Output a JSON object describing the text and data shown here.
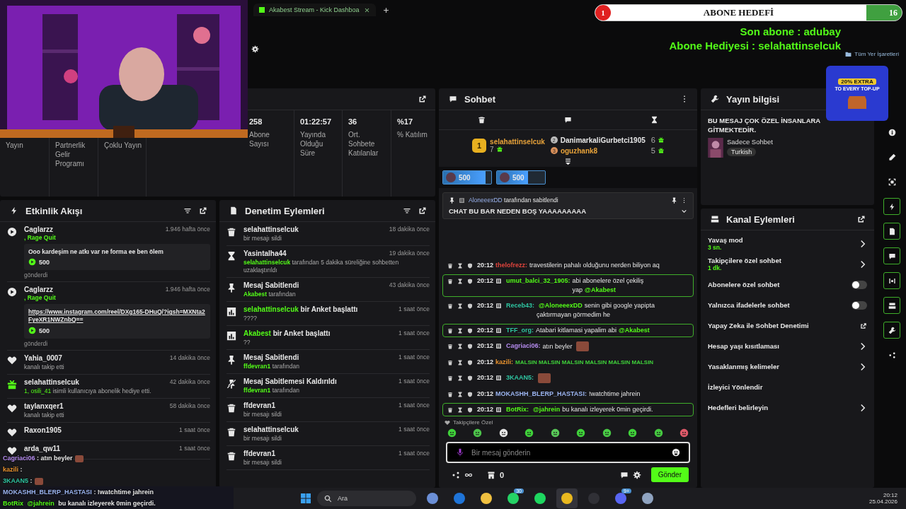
{
  "browser": {
    "tab_title": "Akabest Stream - Kick Dashboa",
    "bookmarks": "Tüm Yer İşaretleri"
  },
  "webcam": {
    "kind": "picture"
  },
  "sub_goal": {
    "title": "ABONE HEDEFİ",
    "current": "1",
    "target": "16"
  },
  "overlay_notices": [
    "Son abone : adubay",
    "Abone Hediyesi : selahattinselcuk"
  ],
  "ad": {
    "headline": "20% EXTRA",
    "subline": "TO EVERY TOP-UP"
  },
  "stats": [
    {
      "label": "Yayın"
    },
    {
      "label": "Partnerlik Gelir Programı"
    },
    {
      "label": "Çoklu Yayın"
    },
    {
      "value": "258",
      "label": "Abone Sayısı"
    },
    {
      "value": "01:22:57",
      "label": "Yayında Olduğu Süre"
    },
    {
      "value": "36",
      "label": "Ort. Sohbete Katılanlar"
    },
    {
      "value": "%17",
      "label": "% Katılım"
    }
  ],
  "events": {
    "title": "Etkinlik Akışı",
    "items": [
      {
        "kind": "kicks",
        "user": "Caglarzz",
        "sub": ", Rage Quit",
        "time": "1.946 hafta önce",
        "message": "Ooo kardeşim ne atkı var ne forma ee ben ölem",
        "link": false,
        "amount": "500",
        "footer": "gönderdi"
      },
      {
        "kind": "kicks",
        "user": "Caglarzz",
        "sub": ", Rage Quit",
        "time": "1.946 hafta önce",
        "message": "https://www.instagram.com/reel/DXg165-DHuQ/?igsh=MXNta2FyeXR1NWZnbQ==",
        "link": true,
        "amount": "500",
        "footer": "gönderdi"
      },
      {
        "kind": "follow",
        "user": "Yahia_0007",
        "time": "14 dakika önce",
        "text": "kanalı takip etti"
      },
      {
        "kind": "gift",
        "user": "selahattinselcuk",
        "time": "42 dakika önce",
        "highlight": "1, osili_41",
        "text": "isimli kullanıcıya abonelik hediye etti."
      },
      {
        "kind": "follow",
        "user": "taylanxqer1",
        "time": "58 dakika önce",
        "text": "kanalı takip etti"
      },
      {
        "kind": "follow",
        "user": "Raxon1905",
        "time": "1 saat önce"
      },
      {
        "kind": "follow",
        "user": "arda_qw11",
        "time": "1 saat önce"
      }
    ]
  },
  "moderation": {
    "title": "Denetim Eylemleri",
    "items": [
      {
        "kind": "delete",
        "title": "selahattinselcuk",
        "sub": "bir mesajı sildi",
        "time": "18 dakika önce"
      },
      {
        "kind": "timeout",
        "title": "Yasintalha44",
        "actor": "selahattinselcuk",
        "sub": "tarafından 5 dakika süreliğine sohbetten uzaklaştırıldı",
        "time": "19 dakika önce"
      },
      {
        "kind": "pin",
        "title": "Mesaj Sabitlendi",
        "actor": "Akabest",
        "sub": "tarafından",
        "time": "43 dakika önce"
      },
      {
        "kind": "poll",
        "title_actor": "selahattinselcuk",
        "title": "bir Anket başlattı",
        "sub": "????",
        "time": "1 saat önce"
      },
      {
        "kind": "poll",
        "title_actor": "Akabest",
        "title": "bir Anket başlattı",
        "sub": "??",
        "time": "1 saat önce"
      },
      {
        "kind": "pin",
        "title": "Mesaj Sabitlendi",
        "actor": "ffdevran1",
        "sub": "tarafından",
        "time": "1 saat önce"
      },
      {
        "kind": "unpin",
        "title": "Mesaj Sabitlemesi Kaldırıldı",
        "actor": "ffdevran1",
        "sub": "tarafından",
        "time": "1 saat önce"
      },
      {
        "kind": "delete",
        "title": "ffdevran1",
        "sub": "bir mesajı sildi",
        "time": "1 saat önce"
      },
      {
        "kind": "delete",
        "title": "selahattinselcuk",
        "sub": "bir mesajı sildi",
        "time": "1 saat önce"
      },
      {
        "kind": "delete",
        "title": "ffdevran1",
        "sub": "bir mesajı sildi",
        "time": "1 saat önce"
      }
    ]
  },
  "chat": {
    "title": "Sohbet",
    "leaders": [
      {
        "rank": "1",
        "name": "selahattinselcuk",
        "count": "7",
        "color": "#e8a33a"
      },
      {
        "rank": "2",
        "name": "DanimarkaliGurbetci1905",
        "count": "6",
        "color": "#e8e8e8"
      },
      {
        "rank": "3",
        "name": "oguzhank8",
        "count": "5",
        "color": "#e8a33a"
      }
    ],
    "gifts": [
      {
        "amount": "500",
        "level": 0.88
      },
      {
        "amount": "500",
        "level": 0.65
      }
    ],
    "pinned": {
      "by": "AloneeexDD",
      "note": "tarafından sabitlendi",
      "text": "CHAT BU BAR NEDEN BOŞ YAAAAAAAAA"
    },
    "messages": [
      {
        "time": "20:12",
        "user": "thelofrezz:",
        "color": "#e0443c",
        "badge": false,
        "highlight": false,
        "emote": false,
        "parts": [
          {
            "kind": "text",
            "text": "travestilerin pahalı olduğunu nerden biliyon aq"
          }
        ]
      },
      {
        "time": "20:12",
        "user": "umut_balci_32_1905:",
        "color": "#53fc18",
        "badge": true,
        "highlight": true,
        "emote": false,
        "parts": [
          {
            "kind": "text",
            "text": "abi abonelere özel çekiliş yap"
          },
          {
            "kind": "mention",
            "text": "@Akabest"
          }
        ]
      },
      {
        "time": "20:12",
        "user": "Receb43:",
        "color": "#2ec4a0",
        "badge": true,
        "highlight": false,
        "emote": false,
        "parts": [
          {
            "kind": "mention",
            "text": "@AloneeexDD"
          },
          {
            "kind": "text",
            "text": "senin gibi google yapipta çaktırmayan görmedim he"
          }
        ]
      },
      {
        "time": "20:12",
        "user": "TFF_org:",
        "color": "#2ec4a0",
        "badge": true,
        "highlight": true,
        "emote": false,
        "parts": [
          {
            "kind": "text",
            "text": "Atabari kitlamasi yapalim abi"
          },
          {
            "kind": "mention",
            "text": "@Akabest"
          }
        ]
      },
      {
        "time": "20:12",
        "user": "Cagriaci06:",
        "color": "#b68cf0",
        "badge": true,
        "highlight": false,
        "emote": true,
        "parts": [
          {
            "kind": "text",
            "text": "atın beyler"
          }
        ]
      },
      {
        "time": "20:12",
        "user": "kazili:",
        "color": "#e8922e",
        "badge": false,
        "highlight": false,
        "emote": false,
        "parts": [
          {
            "kind": "small",
            "text": "MALSIN MALSIN MALSIN MALSIN MALSIN MALSIN"
          }
        ]
      },
      {
        "time": "20:12",
        "user": "3KAAN5:",
        "color": "#2ec4a0",
        "badge": true,
        "highlight": false,
        "emote": true
      },
      {
        "time": "20:12",
        "user": "MOKASHH_BLERP_HASTASI:",
        "color": "#9bb4f0",
        "badge": false,
        "highlight": false,
        "emote": false,
        "parts": [
          {
            "kind": "text",
            "text": "!watchtime jahrein"
          }
        ]
      },
      {
        "time": "20:12",
        "user": "BotRix:",
        "color": "#53fc18",
        "badge": true,
        "highlight": true,
        "emote": false,
        "parts": [
          {
            "kind": "mention",
            "text": "@jahrein"
          },
          {
            "kind": "text",
            "text": "bu kanalı izleyerek 0min geçirdi."
          }
        ]
      }
    ],
    "followers_only": "Takipçilere Özel",
    "input": {
      "placeholder": "Bir mesaj gönderin"
    },
    "store_count": "0",
    "send": "Gönder"
  },
  "stream_info": {
    "title": "Yayın bilgisi",
    "stream_title": "BU MESAJ ÇOK ÖZEL İNSANLARA GİTMEKTEDİR.",
    "category": "Sadece Sohbet",
    "tag": "Turkish"
  },
  "channel_actions": {
    "title": "Kanal Eylemleri",
    "items": [
      {
        "kind": "chevron",
        "label": "Yavaş mod",
        "value": "3 sn."
      },
      {
        "kind": "chevron",
        "label": "Takipçilere özel sohbet",
        "value": "1 dk."
      },
      {
        "kind": "toggle",
        "label": "Abonelere özel sohbet",
        "on": false
      },
      {
        "kind": "toggle",
        "label": "Yalnızca ifadelerle sohbet",
        "on": false
      },
      {
        "kind": "external",
        "label": "Yapay Zeka ile Sohbet Denetimi"
      },
      {
        "kind": "chevron",
        "label": "Hesap yaşı kısıtlaması"
      },
      {
        "kind": "chevron",
        "label": "Yasaklanmış kelimeler"
      },
      {
        "kind": "plain",
        "label": "İzleyici Yönlendir"
      },
      {
        "kind": "chevron",
        "label": "Hedefleri belirleyin"
      }
    ]
  },
  "sidebar": [
    {
      "kind": "info",
      "active": false
    },
    {
      "kind": "pencil",
      "active": false
    },
    {
      "kind": "focus",
      "active": false
    },
    {
      "kind": "bolt",
      "active": true
    },
    {
      "kind": "doc",
      "active": true
    },
    {
      "kind": "chat",
      "active": true
    },
    {
      "kind": "broadcast",
      "active": true
    },
    {
      "kind": "channel",
      "active": true
    },
    {
      "kind": "wrench",
      "active": true
    },
    {
      "kind": "dots",
      "active": false
    }
  ],
  "overlay_chat": [
    {
      "user": "Cagriaci06",
      "color": "#b68cf0",
      "text": ": atın beyler",
      "emote": true
    },
    {
      "user": "kazili",
      "color": "#e8922e",
      "text": ":",
      "emote": false
    },
    {
      "user": "3KAAN5",
      "color": "#2ec4a0",
      "text": ":",
      "emote": true
    },
    {
      "user": "MOKASHH_BLERP_HASTASI",
      "color": "#9bb4f0",
      "text": ": !watchtime jahrein",
      "emote": false
    },
    {
      "user": "BotRix",
      "color": "#53fc18",
      "mention": "@jahrein",
      "text": "bu kanalı izleyerek 0min geçirdi.",
      "emote": false
    }
  ],
  "taskbar": {
    "search": "Ara",
    "time": "20:12",
    "date": "25.04.2026",
    "apps": [
      {
        "kind": "taskview",
        "selected": false
      },
      {
        "kind": "mail",
        "selected": false
      },
      {
        "kind": "folder",
        "selected": false
      },
      {
        "kind": "whatsapp",
        "badge": "30",
        "selected": false
      },
      {
        "kind": "spotify",
        "selected": false
      },
      {
        "kind": "chrome",
        "selected": true
      },
      {
        "kind": "obs",
        "selected": false
      },
      {
        "kind": "discord",
        "badge": "9+",
        "selected": false
      },
      {
        "kind": "settings",
        "selected": false
      }
    ]
  }
}
